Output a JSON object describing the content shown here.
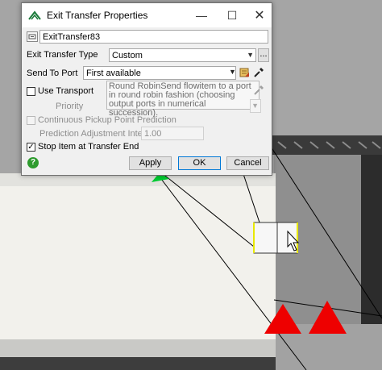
{
  "window": {
    "title": "Exit Transfer Properties",
    "minimize_glyph": "—",
    "maximize_glyph": "☐",
    "close_glyph": "✕"
  },
  "name_field": {
    "value": "ExitTransfer83"
  },
  "exit_transfer_type": {
    "label": "Exit Transfer Type",
    "value": "Custom",
    "more_label": "..."
  },
  "send_to_port": {
    "label": "Send To Port",
    "value": "First available"
  },
  "tooltip": {
    "text": "Round RobinSend flowitem to a port in round robin fashion (choosing output ports in numerical succession)."
  },
  "use_transport": {
    "label": "Use Transport",
    "checked": false
  },
  "priority": {
    "label": "Priority"
  },
  "continuous_pickup": {
    "label": "Continuous Pickup Point Prediction",
    "checked": false
  },
  "prediction_interval": {
    "label": "Prediction Adjustment Interval",
    "value": "1.00"
  },
  "stop_item": {
    "label": "Stop Item at Transfer End",
    "checked": true,
    "check_glyph": "✓"
  },
  "buttons": {
    "help": "?",
    "apply": "Apply",
    "ok": "OK",
    "cancel": "Cancel"
  },
  "colors": {
    "scene_floor": "#f2f1ec",
    "scene_conveyor": "#3d3d3d",
    "marker_red": "#ee0000",
    "marker_green": "#00cc33",
    "help_green": "#2e9b2e"
  },
  "icons": [
    "app-icon",
    "object-icon",
    "scroll-icon",
    "eyedropper-icon",
    "help-icon"
  ]
}
